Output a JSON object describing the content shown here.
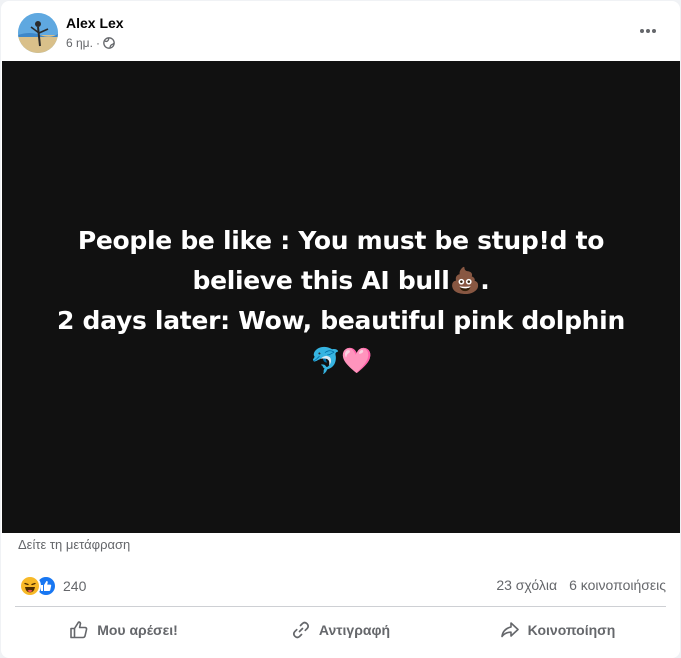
{
  "post": {
    "author": "Alex Lex",
    "time": "6 ημ.",
    "meta_separator": "·",
    "privacy_icon": "globe-icon",
    "more_icon": "more-horizontal-icon",
    "text_lines": [
      "People be like : You must be stup!d to",
      "believe this AI bull💩.",
      "2 days later: Wow, beautiful pink dolphin",
      "🐬🩷"
    ],
    "media_background": "#111111",
    "see_translation": "Δείτε τη μετάφραση"
  },
  "reactions": {
    "icons": [
      "haha-reaction-icon",
      "like-reaction-icon"
    ],
    "count": "240",
    "comments": "23 σχόλια",
    "shares": "6 κοινοποιήσεις"
  },
  "actions": {
    "like": "Μου αρέσει!",
    "copy": "Αντιγραφή",
    "share": "Κοινοποίηση"
  },
  "colors": {
    "secondary_text": "#65676b",
    "like_blue": "#1877f2",
    "haha_yellow": "#f7b928"
  }
}
